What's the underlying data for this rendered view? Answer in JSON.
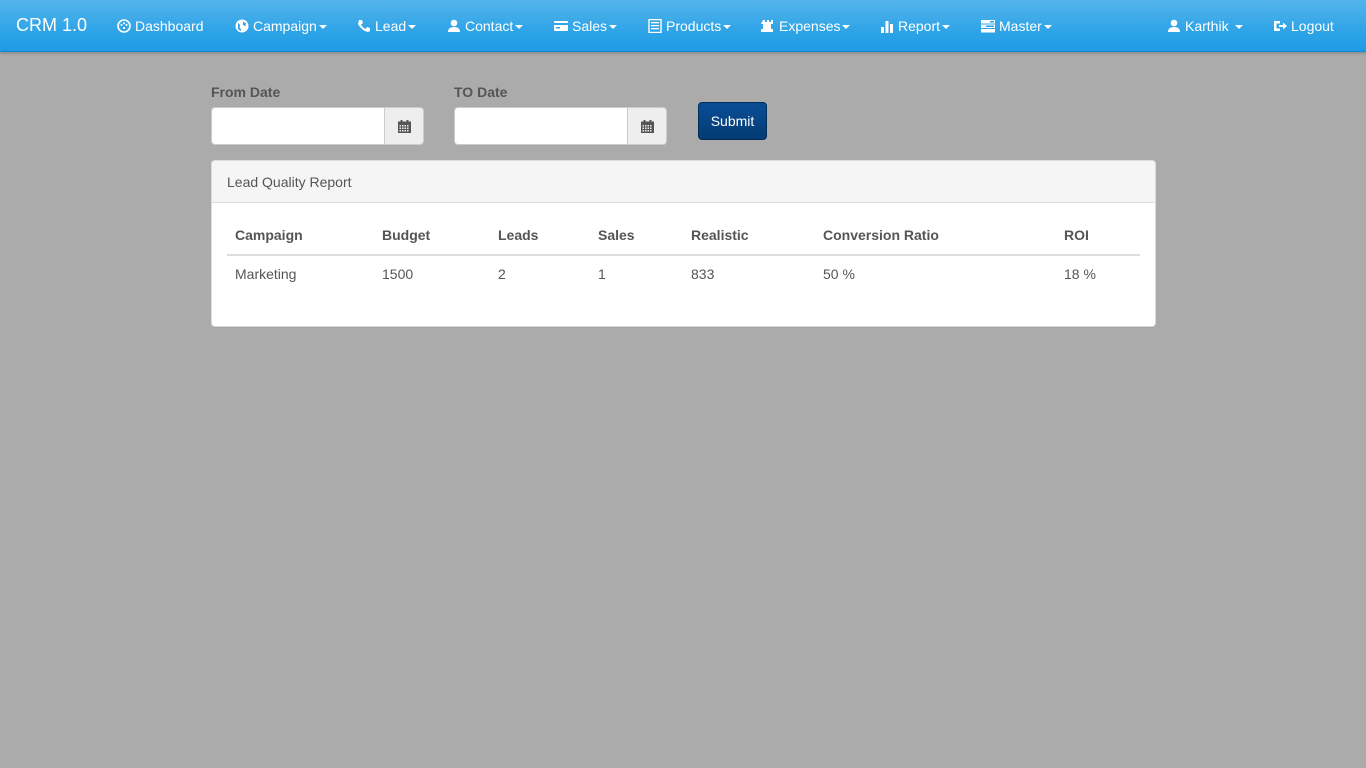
{
  "app": {
    "brand": "CRM 1.0"
  },
  "nav": {
    "items": [
      {
        "label": "Dashboard",
        "icon": "dashboard-icon",
        "dropdown": false
      },
      {
        "label": "Campaign",
        "icon": "globe-icon",
        "dropdown": true
      },
      {
        "label": "Lead",
        "icon": "phone-icon",
        "dropdown": true
      },
      {
        "label": "Contact",
        "icon": "user-icon",
        "dropdown": true
      },
      {
        "label": "Sales",
        "icon": "credit-card-icon",
        "dropdown": true
      },
      {
        "label": "Products",
        "icon": "list-alt-icon",
        "dropdown": true
      },
      {
        "label": "Expenses",
        "icon": "tower-icon",
        "dropdown": true
      },
      {
        "label": "Report",
        "icon": "bar-chart-icon",
        "dropdown": true
      },
      {
        "label": "Master",
        "icon": "tasks-icon",
        "dropdown": true
      }
    ],
    "user": {
      "label": "Karthik",
      "icon": "user-icon"
    },
    "logout": {
      "label": "Logout",
      "icon": "log-out-icon"
    }
  },
  "filters": {
    "from_label": "From Date",
    "from_value": "",
    "to_label": "TO Date",
    "to_value": "",
    "submit_label": "Submit"
  },
  "report": {
    "title": "Lead Quality Report",
    "columns": [
      "Campaign",
      "Budget",
      "Leads",
      "Sales",
      "Realistic",
      "Conversion Ratio",
      "ROI"
    ],
    "rows": [
      [
        "Marketing",
        "1500",
        "2",
        "1",
        "833",
        "50 %",
        "18 %"
      ]
    ]
  }
}
